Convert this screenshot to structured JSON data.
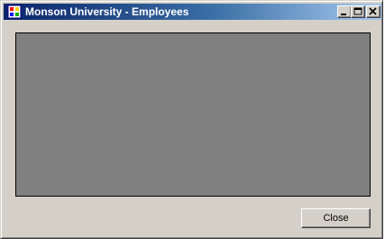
{
  "window": {
    "title": "Monson University - Employees",
    "title_icon": "form-app-icon",
    "caption_buttons": [
      "minimize",
      "maximize",
      "close"
    ]
  },
  "main": {
    "grid": {
      "state": "empty"
    }
  },
  "footer": {
    "close_label": "Close"
  },
  "colors": {
    "face": "#d4d0c8",
    "title_gradient_start": "#0a246a",
    "title_gradient_end": "#a6caf0",
    "grid_background": "#808080"
  }
}
